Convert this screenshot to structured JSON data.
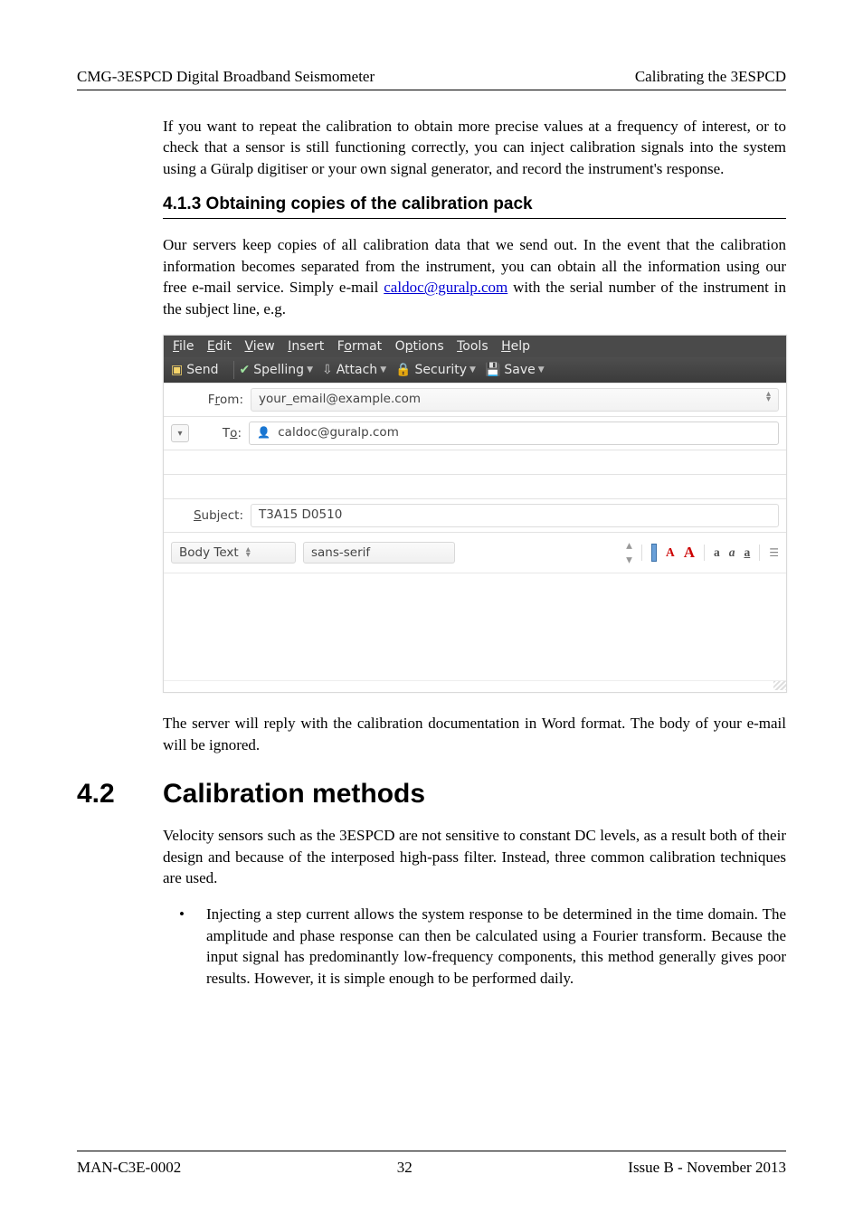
{
  "header": {
    "left": "CMG-3ESPCD Digital Broadband Seismometer",
    "right": "Calibrating the 3ESPCD"
  },
  "body": {
    "para_intro": "If you want to repeat the calibration to obtain more precise values at a frequency of interest, or to check that a sensor is still functioning correctly, you can inject calibration signals into the system using a Güralp digitiser or your own signal generator, and record the instrument's response.",
    "sub_heading": "4.1.3  Obtaining copies of the calibration pack",
    "para_obtain_a": "Our servers keep copies of all calibration data that we send out.  In the event that the calibration information becomes separated from the instrument, you can obtain all the information using our free e-mail service.  Simply e-mail ",
    "link_text": "caldoc@guralp.com",
    "para_obtain_b": " with the serial number of the instrument in the subject line, e.g.",
    "para_reply": "The server will reply with the calibration documentation in Word format. The body of your e-mail will be ignored.",
    "section_num": "4.2",
    "section_title": "Calibration methods",
    "para_velocity": "Velocity sensors such as the 3ESPCD are not sensitive to constant DC levels, as a result both of their design and because of the interposed high-pass filter. Instead, three common calibration techniques are used.",
    "bullet1": "Injecting a step current allows the system response to be determined in the time domain.  The amplitude and phase response can then be calculated using a Fourier transform.  Because the input signal has predominantly low-frequency components, this method generally gives poor results.  However, it is simple enough to be performed daily."
  },
  "email": {
    "menu": {
      "file": "File",
      "edit": "Edit",
      "view": "View",
      "insert": "Insert",
      "format": "Format",
      "options": "Options",
      "tools": "Tools",
      "help": "Help"
    },
    "toolbar": {
      "send": "Send",
      "spelling": "Spelling",
      "attach": "Attach",
      "security": "Security",
      "save": "Save"
    },
    "labels": {
      "from": "From:",
      "to": "To:",
      "subject": "Subject:"
    },
    "from_value": "your_email@example.com",
    "to_value": "caldoc@guralp.com",
    "subject_value": "T3A15 D0510",
    "style_value": "Body Text",
    "font_value": "sans-serif"
  },
  "footer": {
    "left": "MAN-C3E-0002",
    "center": "32",
    "right": "Issue B  - November 2013"
  }
}
